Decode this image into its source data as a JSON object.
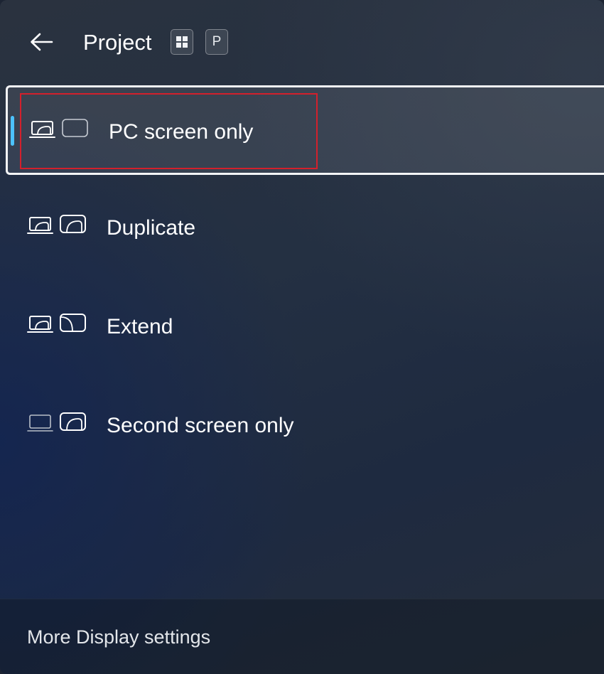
{
  "header": {
    "title": "Project",
    "shortcut_key_letter": "P",
    "shortcut_icons": [
      "windows-logo-icon"
    ],
    "back_icon": "arrow-left-icon"
  },
  "options": [
    {
      "label": "PC screen only",
      "icon": "pc-screen-only-icon",
      "selected": true
    },
    {
      "label": "Duplicate",
      "icon": "duplicate-icon",
      "selected": false
    },
    {
      "label": "Extend",
      "icon": "extend-icon",
      "selected": false
    },
    {
      "label": "Second screen only",
      "icon": "second-screen-only-icon",
      "selected": false
    }
  ],
  "footer": {
    "link_label": "More Display settings"
  },
  "colors": {
    "accent": "#4cc2ff",
    "highlight_outline": "#d3202c",
    "selected_border": "#f4f5f7"
  }
}
